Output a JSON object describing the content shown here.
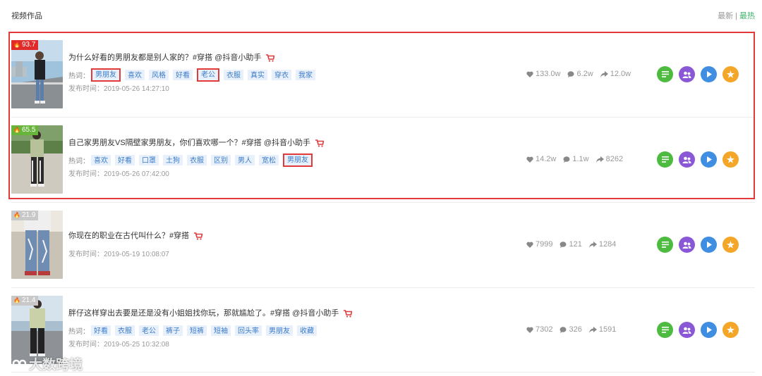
{
  "header": {
    "title": "视频作品",
    "sort_new": "最新",
    "sort_sep": "|",
    "sort_hot": "最热"
  },
  "videos": [
    {
      "heat": "93.7",
      "heat_color": "#e02b2b",
      "title": "为什么好看的男朋友都是别人家的？#穿搭 @抖音小助手",
      "tags_label": "热词：",
      "tags": [
        "男朋友",
        "喜欢",
        "风格",
        "好看",
        "老公",
        "衣服",
        "真实",
        "穿衣",
        "我家"
      ],
      "time": "发布时间：2019-05-26 14:27:10",
      "likes": "133.0w",
      "comments": "6.2w",
      "shares": "12.0w"
    },
    {
      "heat": "65.5",
      "heat_color": "#67b53a",
      "title": "自己家男朋友VS隔壁家男朋友，你们喜欢哪一个？#穿搭 @抖音小助手",
      "tags_label": "热词：",
      "tags": [
        "喜欢",
        "好看",
        "口罩",
        "土狗",
        "衣服",
        "区别",
        "男人",
        "宽松",
        "男朋友"
      ],
      "time": "发布时间：2019-05-26 07:42:00",
      "likes": "14.2w",
      "comments": "1.1w",
      "shares": "8262"
    },
    {
      "heat": "21.9",
      "heat_color": "#c8c8c8",
      "title": "你现在的职业在古代叫什么？#穿搭",
      "time": "发布时间：2019-05-19 10:08:07",
      "likes": "7999",
      "comments": "121",
      "shares": "1284"
    },
    {
      "heat": "21.4",
      "heat_color": "#c8c8c8",
      "title": "胖仔这样穿出去要是还是没有小姐姐找你玩，那就尴尬了。#穿搭 @抖音小助手",
      "tags_label": "热词：",
      "tags": [
        "好看",
        "衣服",
        "老公",
        "裤子",
        "短裤",
        "短袖",
        "回头率",
        "男朋友",
        "收藏"
      ],
      "time": "发布时间：2019-05-25 10:32:08",
      "likes": "7302",
      "comments": "326",
      "shares": "1591"
    }
  ],
  "icons": {
    "flame": "flame-icon",
    "cart": "cart-icon",
    "heart": "heart-icon",
    "comment": "comment-icon",
    "share": "share-icon",
    "detail": "list-icon",
    "fans": "fans-icon",
    "play": "play-icon",
    "star": "star-icon"
  },
  "colors": {
    "highlight": "#e23a3a",
    "tag_bg": "#e8f1fb",
    "tag_text": "#3d7cc9",
    "active_sort": "#3db36a"
  },
  "watermark": "大数跨境"
}
